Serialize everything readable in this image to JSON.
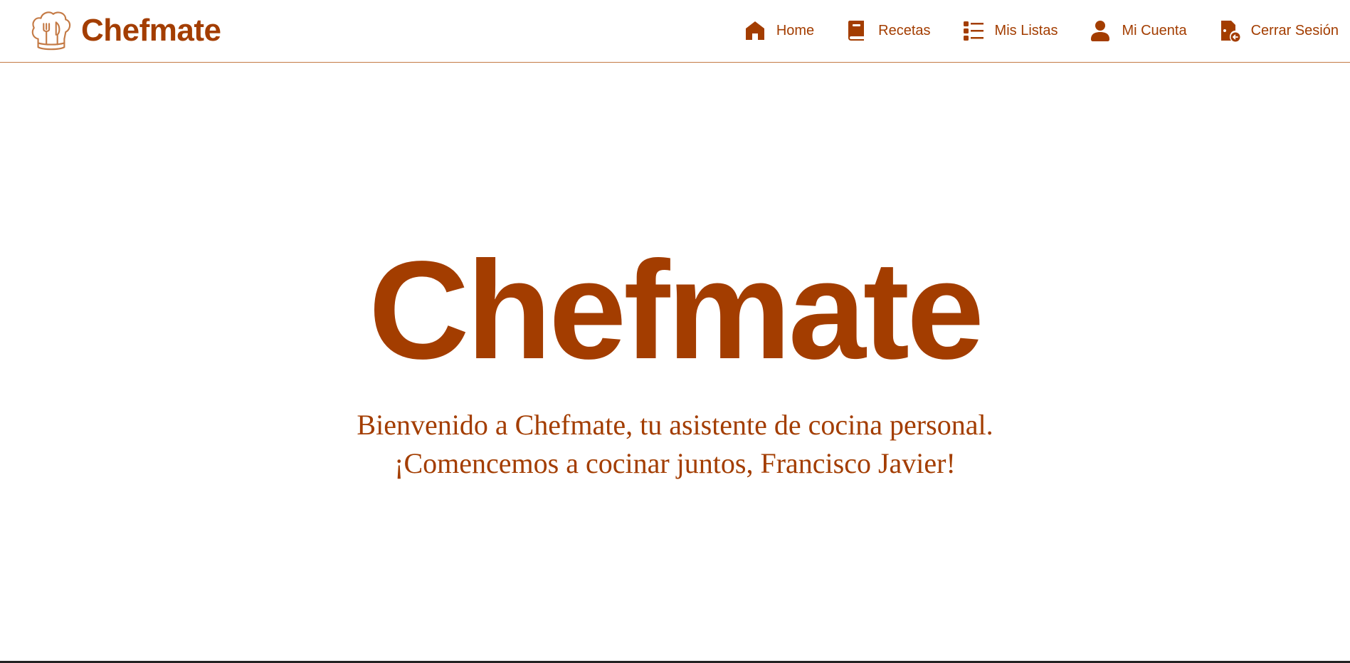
{
  "colors": {
    "brand": "#a33d00",
    "border": "#c47a45",
    "background": "#ffffff"
  },
  "header": {
    "brand_name": "Chefmate",
    "logo_icon": "chef-hat-utensils-icon"
  },
  "nav": {
    "items": [
      {
        "label": "Home",
        "icon": "home-icon"
      },
      {
        "label": "Recetas",
        "icon": "book-icon"
      },
      {
        "label": "Mis Listas",
        "icon": "list-icon"
      },
      {
        "label": "Mi Cuenta",
        "icon": "user-icon"
      },
      {
        "label": "Cerrar Sesión",
        "icon": "logout-icon"
      }
    ]
  },
  "hero": {
    "title": "Chefmate",
    "subtitle_line1": "Bienvenido a Chefmate, tu asistente de cocina personal.",
    "subtitle_line2": "¡Comencemos a cocinar juntos, Francisco Javier!"
  }
}
